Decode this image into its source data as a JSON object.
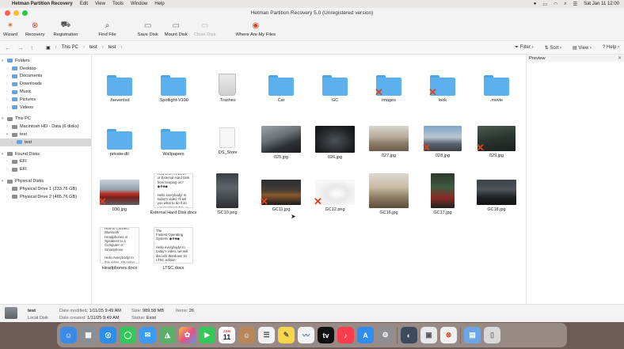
{
  "menubar": {
    "apple": "",
    "app_name": "Hetman Partition Recovery",
    "menus": [
      "Edit",
      "View",
      "Tools",
      "Window",
      "Help"
    ],
    "clock": "Sat Jan 11  12:00"
  },
  "window": {
    "title": "Hetman Partition Recovery 5.0 (Unregistered version)"
  },
  "toolbar": {
    "wizard": "Wizard",
    "recovery": "Recovery",
    "registration": "Registration",
    "find_file": "Find File",
    "save_disk": "Save Disk",
    "mount_disk": "Mount Disk",
    "close_disk": "Close Disk",
    "where_files": "Where Are My Files"
  },
  "navbar": {
    "path": [
      "This PC",
      "test",
      "test"
    ],
    "filter": "Filter",
    "sort": "Sort",
    "view": "View",
    "help": "Help"
  },
  "sidebar": {
    "folders_header": "Folders",
    "folders": [
      "Desktop",
      "Documents",
      "Downloads",
      "Music",
      "Pictures",
      "Videos"
    ],
    "this_pc_header": "This PC",
    "this_pc": [
      "Macintosh HD - Data (6 disks)",
      "test",
      "test"
    ],
    "found_header": "Found Disks",
    "found": [
      "EFI",
      "EFI"
    ],
    "physical_header": "Physical Disks",
    "physical": [
      "Physical Drive 1 (233.76 GB)",
      "Physical Drive 2 (465.76 GB)"
    ]
  },
  "preview": {
    "title": "Preview"
  },
  "files": {
    "r1": [
      ".fseventsd",
      ".Spotlight-V100",
      ".Trashes",
      "Car",
      "GC",
      "images",
      "look",
      ".movie"
    ],
    "r2": [
      "private-dir",
      "Wallpapers",
      ".DS_Store",
      "025.jpg",
      "026.jpg",
      "027.jpg",
      "028.jpg",
      "029.jpg"
    ],
    "r3": [
      "030.jpg",
      "External Hard Disk.docx",
      "GC10.png",
      "GC11.jpg",
      "GC12.png",
      "GC16.jpg",
      "GC17.jpg",
      "GC18.jpg"
    ],
    "r4": [
      "Headphones.docx",
      "LTSC.docx"
    ]
  },
  "doc_previews": {
    "external": "How to a Fell Drive\nor External Hard Disk\nfrom keeping on?\n◆❖■◆\n\nHello everybody! In\ntoday's video I'll tell\nyou what to do if an\nexternal hard disk or",
    "headphones": "How to Connect\nBluetooth\nHeadphones or\nSpeakers to a\nComputer or\nSmartphone\n\nHello everybody! In\nthis video, I'm going",
    "ltsc": "Windows 10 LTSC. The\nFastest Operating\nSystem! ◆❖■◆\n\nHello everybody! In\ntoday's video, we will\ndiscuss Windows 10\nLTSC edition.\nWe will explore its"
  },
  "status": {
    "name": "test",
    "type": "Local Disk",
    "modified_label": "Date modified:",
    "modified": "1/11/25 9:49 AM",
    "created_label": "Date created:",
    "created": "1/11/25 9:49 AM",
    "size_label": "Size:",
    "size": "989.58 MB",
    "status_label": "Status:",
    "status": "Exist",
    "items_label": "Items:",
    "items": "26"
  },
  "dock_date": {
    "month": "JAN",
    "day": "11"
  },
  "colors": {
    "folder": "#5cb0ee",
    "delete_mark": "#d9451e",
    "selection": "#d8d8d8"
  }
}
